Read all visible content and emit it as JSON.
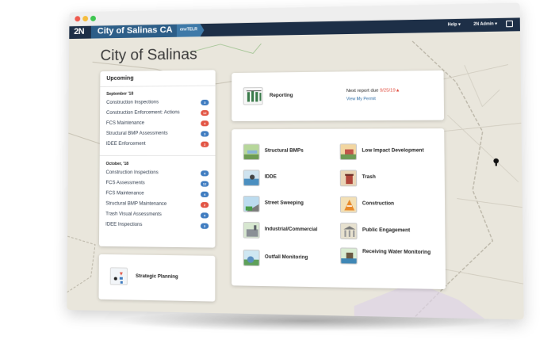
{
  "browser": {
    "controls": [
      "close",
      "minimize",
      "maximize"
    ]
  },
  "nav": {
    "logo": "2N",
    "city": "City of Salinas CA",
    "env": "envTELR",
    "help": "Help ▾",
    "user": "2N Admin ▾",
    "exit_icon": "exit-icon"
  },
  "page": {
    "title": "City of Salinas"
  },
  "upcoming": {
    "title": "Upcoming",
    "groups": [
      {
        "month": "September '18",
        "items": [
          {
            "label": "Construction Inspections",
            "count": "3",
            "color": "#3f7cc0"
          },
          {
            "label": "Construction Enforcement: Actions",
            "count": "12",
            "color": "#e25544"
          },
          {
            "label": "FCS Maintenance",
            "count": "4",
            "color": "#e25544"
          },
          {
            "label": "Structural BMP Assessments",
            "count": "3",
            "color": "#3f7cc0"
          },
          {
            "label": "IDEE Enforcement",
            "count": "2",
            "color": "#e25544"
          }
        ]
      },
      {
        "month": "October, '18",
        "items": [
          {
            "label": "Construction Inspections",
            "count": "4",
            "color": "#3f7cc0"
          },
          {
            "label": "FCS Assessments",
            "count": "12",
            "color": "#3f7cc0"
          },
          {
            "label": "FCS Maintenance",
            "count": "4",
            "color": "#3f7cc0"
          },
          {
            "label": "Structural BMP Maintenance",
            "count": "2",
            "color": "#e25544"
          },
          {
            "label": "Trash Visual Assessments",
            "count": "4",
            "color": "#3f7cc0"
          },
          {
            "label": "IDEE Inspections",
            "count": "3",
            "color": "#3f7cc0"
          }
        ]
      }
    ]
  },
  "strategic": {
    "label": "Strategic Planning",
    "icon": "strategy-icon"
  },
  "reporting": {
    "label": "Reporting",
    "due_prefix": "Next report due ",
    "due_date": "9/25/19",
    "due_marker": "▲",
    "link": "View My Permit",
    "icon": "report-icon"
  },
  "programs": [
    {
      "label": "Structural BMPs",
      "icon": "structural-bmps-icon"
    },
    {
      "label": "Low Impact Development",
      "icon": "low-impact-development-icon"
    },
    {
      "label": "IDDE",
      "icon": "idde-icon"
    },
    {
      "label": "Trash",
      "icon": "trash-icon"
    },
    {
      "label": "Street Sweeping",
      "icon": "street-sweeping-icon"
    },
    {
      "label": "Construction",
      "icon": "construction-icon"
    },
    {
      "label": "Industrial/Commercial",
      "icon": "industrial-commercial-icon"
    },
    {
      "label": "Public Engagement",
      "icon": "public-engagement-icon"
    },
    {
      "label": "Outfall Monitoring",
      "icon": "outfall-monitoring-icon"
    },
    {
      "label": "Receiving Water Monitoring",
      "icon": "receiving-water-monitoring-icon"
    }
  ],
  "colors": {
    "navbar": "#1d2f47",
    "city_tab": "#2d5e88",
    "accent_blue": "#3f7cc0",
    "accent_red": "#e25544",
    "map_bg": "#e9e6dc"
  }
}
